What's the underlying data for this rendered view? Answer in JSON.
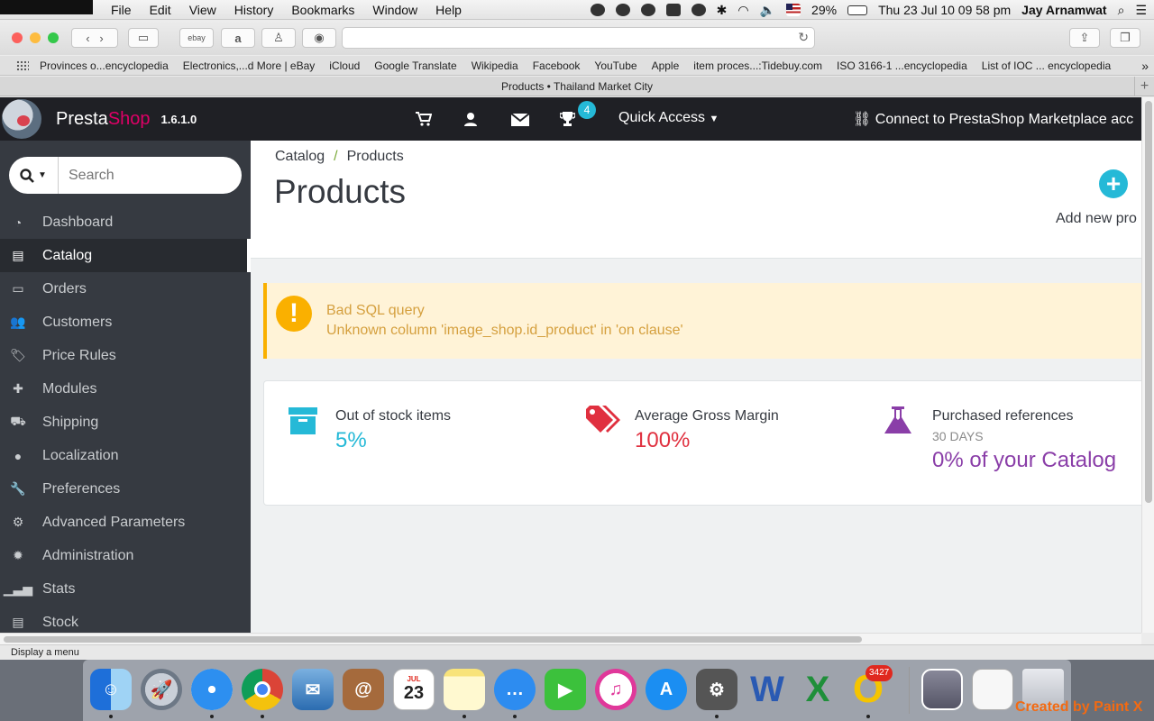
{
  "menubar": {
    "menus": [
      "File",
      "Edit",
      "View",
      "History",
      "Bookmarks",
      "Window",
      "Help"
    ],
    "battery": "29%",
    "datetime": "Thu 23 Jul  10 09 58 pm",
    "user": "Jay Arnamwat"
  },
  "toolbar": {
    "tabs_icons": [
      "ebay"
    ]
  },
  "bookmarks": [
    "Provinces o...encyclopedia",
    "Electronics,...d More | eBay",
    "iCloud",
    "Google Translate",
    "Wikipedia",
    "Facebook",
    "YouTube",
    "Apple",
    "item proces...:Tidebuy.com",
    "ISO 3166-1 ...encyclopedia",
    "List of IOC ... encyclopedia"
  ],
  "tab": {
    "title": "Products • Thailand Market City"
  },
  "header": {
    "brand_a": "Presta",
    "brand_b": "Shop",
    "version": "1.6.1.0",
    "notification_count": "4",
    "quick_access": "Quick Access",
    "connect": "Connect to PrestaShop Marketplace acc"
  },
  "sidebar": {
    "search_placeholder": "Search",
    "items": [
      {
        "label": "Dashboard",
        "icon": "dashboard-icon"
      },
      {
        "label": "Catalog",
        "icon": "book-icon"
      },
      {
        "label": "Orders",
        "icon": "credit-card-icon"
      },
      {
        "label": "Customers",
        "icon": "users-icon"
      },
      {
        "label": "Price Rules",
        "icon": "tags-icon"
      },
      {
        "label": "Modules",
        "icon": "puzzle-icon"
      },
      {
        "label": "Shipping",
        "icon": "truck-icon"
      },
      {
        "label": "Localization",
        "icon": "globe-icon"
      },
      {
        "label": "Preferences",
        "icon": "wrench-icon"
      },
      {
        "label": "Advanced Parameters",
        "icon": "cogs-icon"
      },
      {
        "label": "Administration",
        "icon": "cog-icon"
      },
      {
        "label": "Stats",
        "icon": "bar-chart-icon"
      },
      {
        "label": "Stock",
        "icon": "archive-icon"
      }
    ]
  },
  "main": {
    "breadcrumb": [
      "Catalog",
      "Products"
    ],
    "breadcrumb_sep": "/",
    "title": "Products",
    "add_new_label": "Add new pro",
    "alert": {
      "title": "Bad SQL query",
      "message": "Unknown column 'image_shop.id_product' in 'on clause'"
    },
    "kpis": [
      {
        "label": "Out of stock items",
        "sub": "",
        "value": "5%",
        "color": "#25b9d7",
        "icon": "archive-icon"
      },
      {
        "label": "Average Gross Margin",
        "sub": "",
        "value": "100%",
        "color": "#e0303f",
        "icon": "tags-icon"
      },
      {
        "label": "Purchased references",
        "sub": "30 DAYS",
        "value": "0% of your Catalog",
        "color": "#8a3ea8",
        "icon": "flask-icon"
      }
    ]
  },
  "statusbar": {
    "text": "Display a menu"
  },
  "dock": {
    "calendar_month": "JUL",
    "calendar_day": "23",
    "opera_badge": "3427"
  },
  "watermark": "Created by Paint X"
}
